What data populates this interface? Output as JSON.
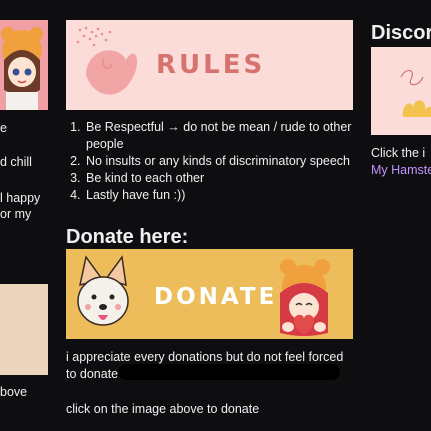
{
  "left_column": {
    "line_1": "e",
    "line_2": "d chill",
    "line_3": "l happy",
    "line_4": "or my",
    "line_5": "bove"
  },
  "rules": {
    "banner_title": "RULES",
    "items": [
      "Be Respectful → do not be mean / rude to other people",
      "No insults or any kinds of discriminatory speech",
      "Be kind to each other",
      "Lastly have fun :))"
    ]
  },
  "donate": {
    "heading": "Donate here:",
    "banner_text": "DONATE",
    "note": "i appreciate every donations but do not feel forced to donate",
    "click_text": "click on the image above to donate"
  },
  "right_column": {
    "heading": "Discor",
    "text": "Click the i",
    "link": "My Hamste"
  },
  "colors": {
    "background": "#0e0e10",
    "text": "#efeff1",
    "link": "#bf94ff",
    "rules_banner": "#fbdcd9",
    "rules_title": "#d6736f",
    "donate_banner": "#ecbd5a"
  }
}
